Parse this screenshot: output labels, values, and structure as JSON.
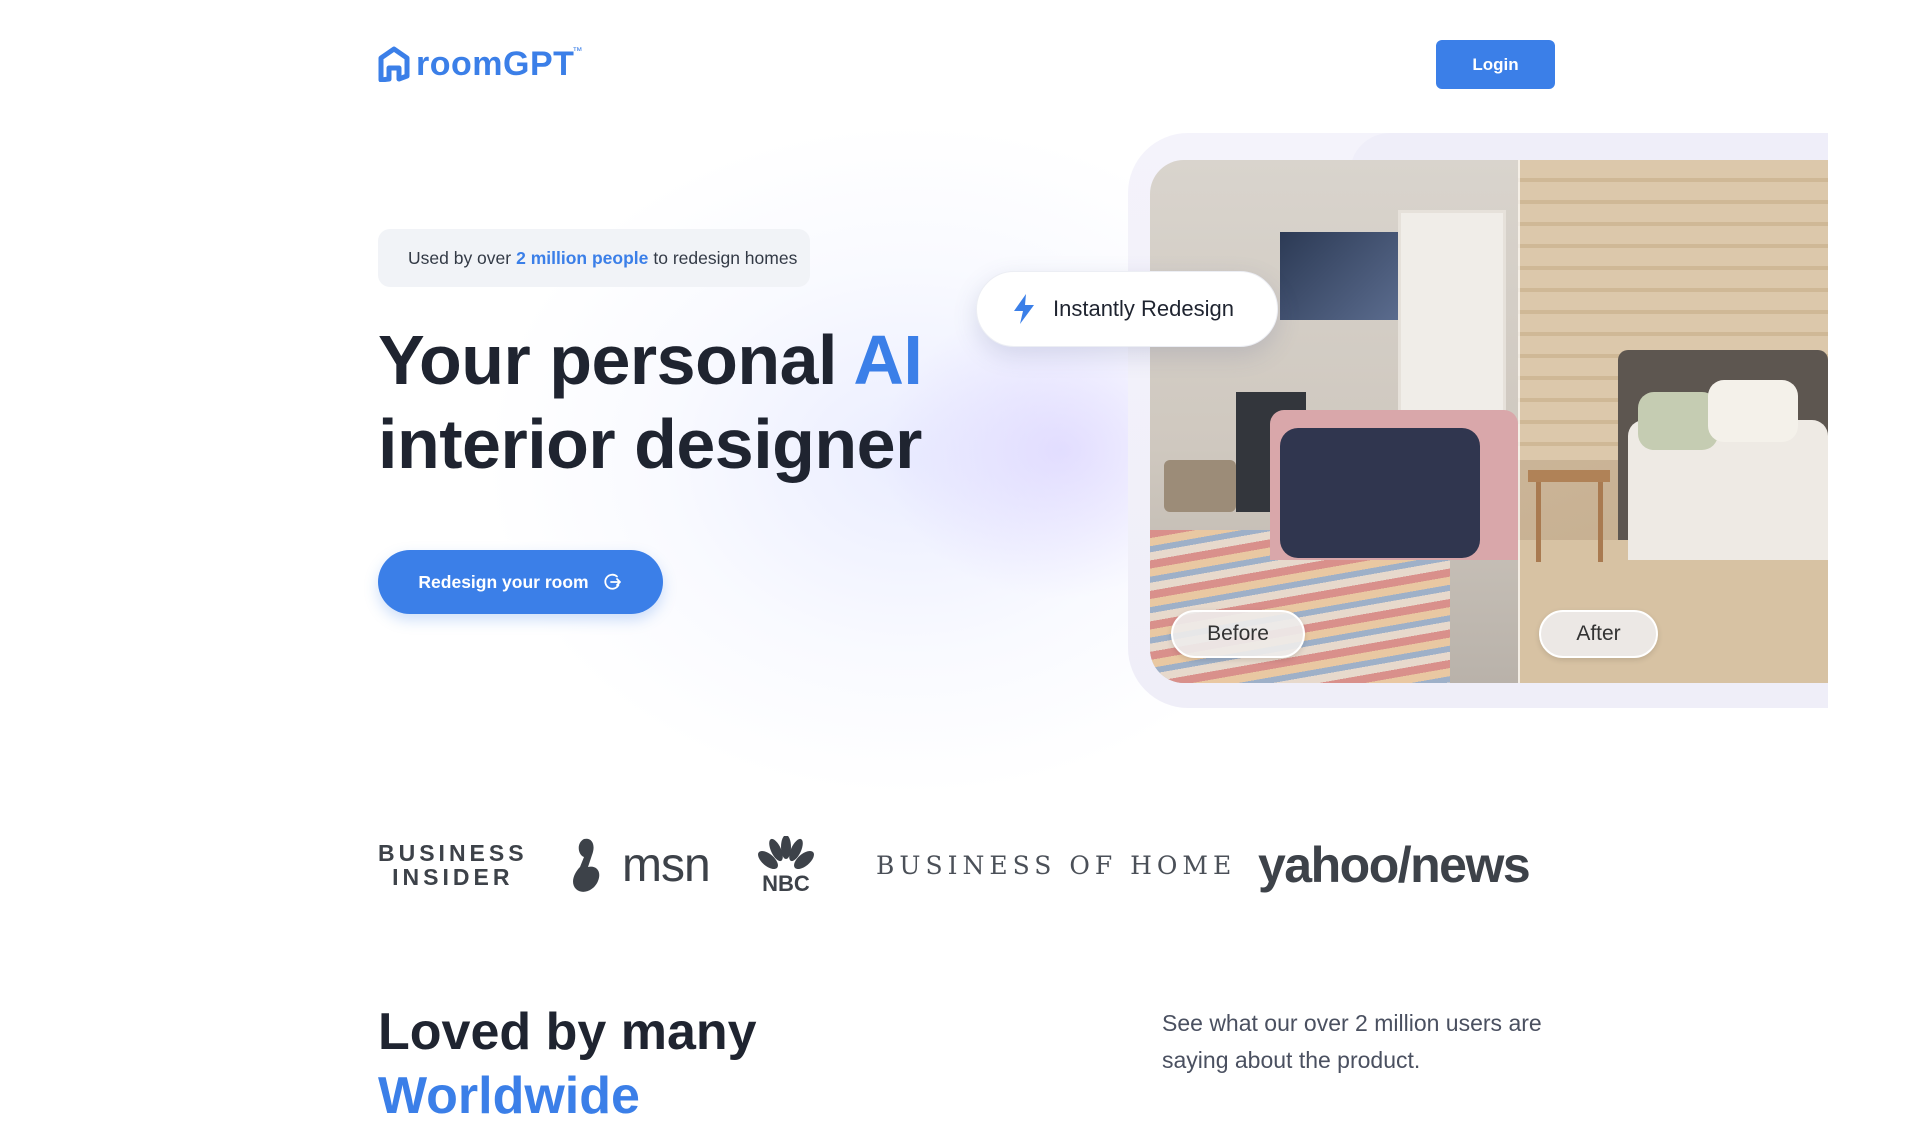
{
  "header": {
    "logo_text": "roomGPT",
    "logo_tm": "™",
    "login_label": "Login"
  },
  "hero": {
    "badge_prefix": "Used by over",
    "badge_highlight": "2 million people",
    "badge_suffix": "to redesign homes",
    "title_line1_prefix": "Your personal",
    "title_line1_accent": "AI",
    "title_line2": "interior designer",
    "cta_label": "Redesign your room",
    "instant_label": "Instantly Redesign",
    "before_label": "Before",
    "after_label": "After"
  },
  "press": {
    "business_insider_line1": "BUSINESS",
    "business_insider_line2": "INSIDER",
    "msn": "msn",
    "nbc": "NBC",
    "business_of_home": "BUSINESS OF HOME",
    "yahoo_news": "yahoo/news"
  },
  "testimonials": {
    "title_line1": "Loved by many",
    "title_line2": "Worldwide",
    "subtitle": "See what our over 2 million users are saying about the product."
  },
  "colors": {
    "accent": "#3b7fe8",
    "heading": "#1f2430",
    "badge_bg": "#f1f3f7"
  },
  "icons": {
    "logo": "house-icon",
    "cta": "arrow-redesign-icon",
    "instant": "lightning-bolt-icon"
  }
}
